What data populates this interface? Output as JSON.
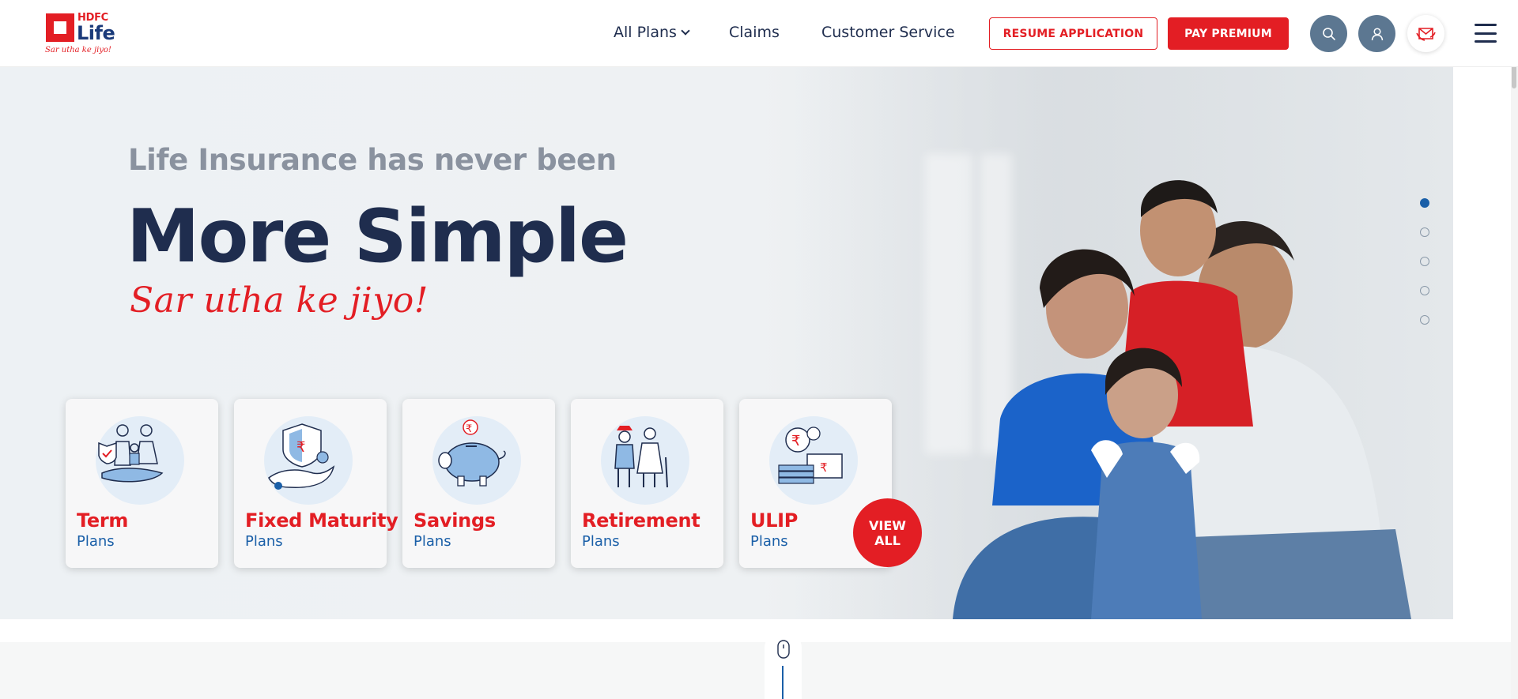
{
  "logo": {
    "brand_top": "HDFC",
    "brand_main": "Life",
    "tagline": "Sar utha ke jiyo!"
  },
  "nav": {
    "all_plans": "All Plans",
    "claims": "Claims",
    "customer_service": "Customer Service"
  },
  "header_buttons": {
    "resume": "RESUME APPLICATION",
    "pay": "PAY PREMIUM"
  },
  "hero": {
    "subtitle": "Life Insurance has never been",
    "title": "More Simple",
    "tagline": "Sar utha ke jiyo!",
    "active_slide": 1,
    "slide_count": 5
  },
  "plans": [
    {
      "title": "Term",
      "subtitle": "Plans",
      "icon": "family-shield-icon"
    },
    {
      "title": "Fixed Maturity",
      "subtitle": "Plans",
      "icon": "rupee-shield-hand-icon"
    },
    {
      "title": "Savings",
      "subtitle": "Plans",
      "icon": "piggy-bank-icon"
    },
    {
      "title": "Retirement",
      "subtitle": "Plans",
      "icon": "elderly-couple-icon"
    },
    {
      "title": "ULIP",
      "subtitle": "Plans",
      "icon": "rupee-coins-notes-icon"
    }
  ],
  "view_all": {
    "line1": "VIEW",
    "line2": "ALL"
  },
  "colors": {
    "brand_red": "#e31e24",
    "brand_blue": "#1a5fa8",
    "navy": "#1f2d4e",
    "icon_circle": "#5c7791"
  }
}
